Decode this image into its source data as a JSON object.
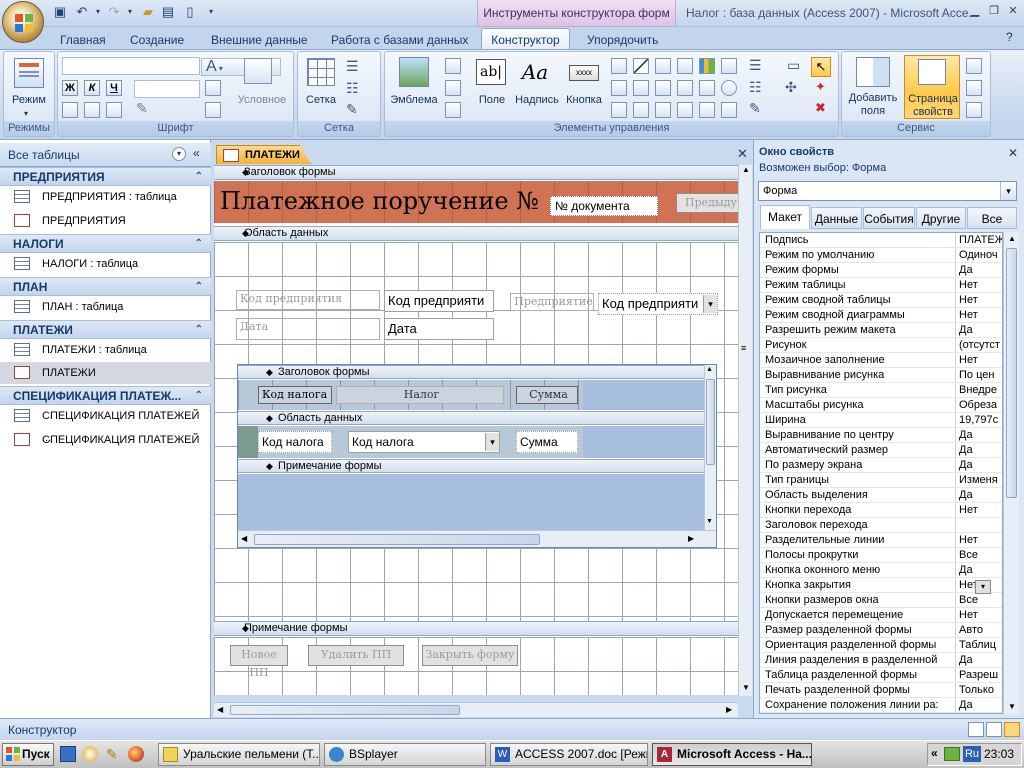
{
  "title_bar": {
    "context_tab": "Инструменты конструктора форм",
    "window_title": "Налог : база данных (Access 2007) - Microsoft Acce..."
  },
  "ribbon": {
    "tabs": [
      "Главная",
      "Создание",
      "Внешние данные",
      "Работа с базами данных",
      "Конструктор",
      "Упорядочить"
    ],
    "active_tab": "Конструктор",
    "groups": {
      "views": {
        "label": "Режимы",
        "view_button": "Режим"
      },
      "font": {
        "label": "Шрифт",
        "bold": "Ж",
        "italic": "К",
        "underline": "Ч",
        "conditional": "Условное"
      },
      "grid": {
        "label": "Сетка",
        "grid_button": "Сетка"
      },
      "controls": {
        "label": "Элементы управления",
        "logo": "Эмблема",
        "field": "Поле",
        "label_btn": "Надпись",
        "button": "Кнопка",
        "title_icon": "ab|",
        "label_icon": "Aa",
        "button_icon": "xxxx"
      },
      "tools": {
        "label": "Сервис",
        "add_fields": "Добавить поля",
        "property_sheet": "Страница свойств"
      }
    }
  },
  "nav": {
    "header": "Все таблицы",
    "groups": [
      {
        "label": "ПРЕДПРИЯТИЯ",
        "items": [
          {
            "label": "ПРЕДПРИЯТИЯ : таблица",
            "kind": "table"
          },
          {
            "label": "ПРЕДПРИЯТИЯ",
            "kind": "form"
          }
        ]
      },
      {
        "label": "НАЛОГИ",
        "items": [
          {
            "label": "НАЛОГИ : таблица",
            "kind": "table"
          }
        ]
      },
      {
        "label": "ПЛАН",
        "items": [
          {
            "label": "ПЛАН : таблица",
            "kind": "table"
          }
        ]
      },
      {
        "label": "ПЛАТЕЖИ",
        "items": [
          {
            "label": "ПЛАТЕЖИ : таблица",
            "kind": "table"
          },
          {
            "label": "ПЛАТЕЖИ",
            "kind": "form",
            "selected": true
          }
        ]
      },
      {
        "label": "СПЕЦИФИКАЦИЯ ПЛАТЕЖ...",
        "items": [
          {
            "label": "СПЕЦИФИКАЦИЯ ПЛАТЕЖЕЙ ...",
            "kind": "table"
          },
          {
            "label": "СПЕЦИФИКАЦИЯ ПЛАТЕЖЕЙ",
            "kind": "form"
          }
        ]
      }
    ]
  },
  "document": {
    "tab": "ПЛАТЕЖИ",
    "sections": {
      "header": "Заголовок формы",
      "detail": "Область данных",
      "footer": "Примечание формы"
    },
    "header_title": "Платежное поручение №",
    "header_field": "№ документа",
    "header_button": "Предыду",
    "detail": {
      "lbl_company_code": "Код предприятия",
      "fld_company_code": "Код предприяти",
      "lbl_company": "Предприятие",
      "cmb_company": "Код предприяти",
      "lbl_date": "Дата",
      "fld_date": "Дата"
    },
    "subform": {
      "sections": {
        "header": "Заголовок формы",
        "detail": "Область данных",
        "footer": "Примечание формы"
      },
      "hdr_tax_code": "Код налога",
      "hdr_tax": "Налог",
      "hdr_sum": "Сумма",
      "fld_tax_code": "Код налога",
      "cmb_tax_code": "Код налога",
      "fld_sum": "Сумма"
    },
    "footer_buttons": [
      "Новое ПП",
      "Удалить ПП",
      "Закрыть форму"
    ]
  },
  "properties": {
    "title": "Окно свойств",
    "selection": "Возможен выбор:  Форма",
    "combo": "Форма",
    "tabs": [
      "Макет",
      "Данные",
      "События",
      "Другие",
      "Все"
    ],
    "active_tab": "Макет",
    "rows": [
      {
        "name": "Подпись",
        "value": "ПЛАТЕЖ"
      },
      {
        "name": "Режим по умолчанию",
        "value": "Одиноч"
      },
      {
        "name": "Режим формы",
        "value": "Да"
      },
      {
        "name": "Режим таблицы",
        "value": "Нет"
      },
      {
        "name": "Режим сводной таблицы",
        "value": "Нет"
      },
      {
        "name": "Режим сводной диаграммы",
        "value": "Нет"
      },
      {
        "name": "Разрешить режим макета",
        "value": "Да"
      },
      {
        "name": "Рисунок",
        "value": "(отсутст"
      },
      {
        "name": "Мозаичное заполнение",
        "value": "Нет"
      },
      {
        "name": "Выравнивание рисунка",
        "value": "По цен"
      },
      {
        "name": "Тип рисунка",
        "value": "Внедре"
      },
      {
        "name": "Масштабы рисунка",
        "value": "Обреза"
      },
      {
        "name": "Ширина",
        "value": "19,797с"
      },
      {
        "name": "Выравнивание по центру",
        "value": "Да"
      },
      {
        "name": "Автоматический размер",
        "value": "Да"
      },
      {
        "name": "По размеру экрана",
        "value": "Да"
      },
      {
        "name": "Тип границы",
        "value": "Изменя"
      },
      {
        "name": "Область выделения",
        "value": "Да"
      },
      {
        "name": "Кнопки перехода",
        "value": "Нет"
      },
      {
        "name": "Заголовок перехода",
        "value": ""
      },
      {
        "name": "Разделительные линии",
        "value": "Нет"
      },
      {
        "name": "Полосы прокрутки",
        "value": "Все"
      },
      {
        "name": "Кнопка оконного меню",
        "value": "Да"
      },
      {
        "name": "Кнопка закрытия",
        "value": "Нет"
      },
      {
        "name": "Кнопки размеров окна",
        "value": "Все"
      },
      {
        "name": "Допускается перемещение",
        "value": "Нет"
      },
      {
        "name": "Размер разделенной формы",
        "value": "Авто"
      },
      {
        "name": "Ориентация разделенной формы",
        "value": "Таблиц"
      },
      {
        "name": "Линия разделения в разделенной",
        "value": "Да"
      },
      {
        "name": "Таблица разделенной формы",
        "value": "Разреш"
      },
      {
        "name": "Печать разделенной формы",
        "value": "Только"
      },
      {
        "name": "Сохранение положения линии ра:",
        "value": "Да"
      }
    ]
  },
  "status": {
    "text": "Конструктор"
  },
  "taskbar": {
    "start": "Пуск",
    "tasks": [
      {
        "label": "Уральские пельмени (Т..."
      },
      {
        "label": "BSplayer"
      },
      {
        "label": "ACCESS 2007.doc [Режи..."
      },
      {
        "label": "Microsoft Access - На...",
        "active": true
      }
    ],
    "lang": "Ru",
    "clock": "23:03",
    "expand": "«"
  },
  "colors": {
    "accent": "#c3d5ec",
    "form_header": "#d07355",
    "doc_tab": "#f3b33d"
  }
}
